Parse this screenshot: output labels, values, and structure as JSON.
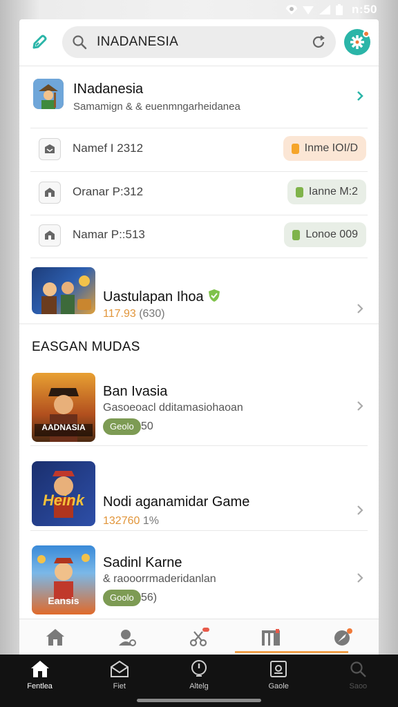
{
  "status_bar": {
    "time": "n:50"
  },
  "search": {
    "value": "INADANESIA"
  },
  "featured_app": {
    "title": "INadanesia",
    "subtitle": "Samamign & & euenmngarheidanea"
  },
  "items": [
    {
      "label": "Namef I 2312",
      "pill": "Inme IOI/D",
      "pill_color": "#f5a52a"
    },
    {
      "label": "Oranar P:312",
      "pill": "Ianne M:2",
      "pill_color": "#7fb34a"
    },
    {
      "label": "Namar P::513",
      "pill": "Lonoe 009",
      "pill_color": "#7fb34a"
    }
  ],
  "promo": {
    "title": "Uastulapan Ihoa",
    "number": "117.93",
    "paren": "(630)"
  },
  "section_title": "EASGAN MUDAS",
  "games": [
    {
      "title": "Ban Ivasia",
      "subtitle": "Gasoeoacl dditamasiohaoan",
      "tag": "Geolo",
      "tag_count": "50",
      "thumb_text": "AADNASIA"
    },
    {
      "title": "Nodi aganamidar Game",
      "number": "132760",
      "suffix": "1%",
      "thumb_text": "Heink"
    },
    {
      "title": "Sadinl Karne",
      "subtitle": "& raooorrmaderidanlan",
      "tag": "Goolo",
      "tag_count": "56)",
      "thumb_text": "Eansis"
    }
  ],
  "bottom_nav": [
    {
      "label": "Fentlea",
      "icon": "home-icon"
    },
    {
      "label": "Fiet",
      "icon": "envelope-icon"
    },
    {
      "label": "Altelg",
      "icon": "alert-icon"
    },
    {
      "label": "Gaole",
      "icon": "game-icon"
    },
    {
      "label": "Saoo",
      "icon": "search-icon"
    }
  ],
  "colors": {
    "accent_teal": "#2bb5a8",
    "accent_orange": "#f0a04a",
    "tag_green": "#7d9b54",
    "number_orange": "#e1953a"
  }
}
